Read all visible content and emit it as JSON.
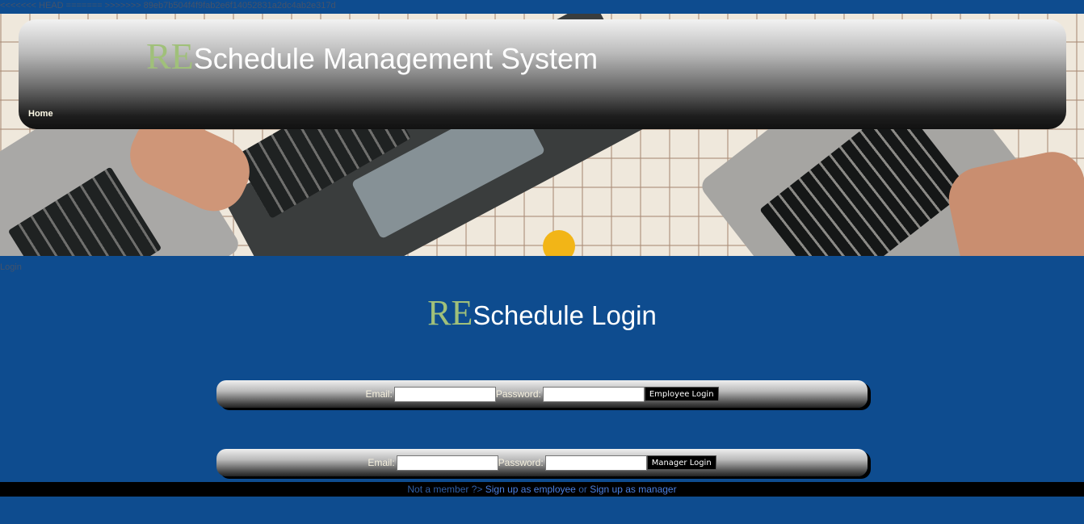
{
  "merge_marker": "<<<<<<< HEAD ======= >>>>>>> 89eb7b504f4f9fab2e6f14052831a2dc4ab2e317d",
  "header": {
    "logo_prefix": "RE",
    "title": "Schedule Management System",
    "nav": {
      "home_label": "Home"
    }
  },
  "breadcrumb": "Login",
  "login": {
    "title_prefix": "RE",
    "title": "Schedule Login",
    "employee_form": {
      "email_label": "Email:",
      "email_value": "",
      "password_label": "Password:",
      "password_value": "",
      "submit_label": "Employee Login"
    },
    "manager_form": {
      "email_label": "Email:",
      "email_value": "",
      "password_label": "Password:",
      "password_value": "",
      "submit_label": "Manager Login"
    }
  },
  "footer": {
    "prompt": "Not a member ?>",
    "signup_employee_label": "Sign up as employee",
    "or_text": "or",
    "signup_manager_label": "Sign up as manager"
  },
  "colors": {
    "page_background": "#0e4c8f",
    "logo_accent": "#a0c07a",
    "footer_link": "#4a7fe0"
  }
}
